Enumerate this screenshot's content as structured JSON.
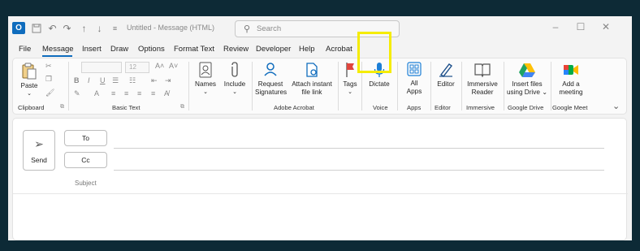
{
  "titlebar": {
    "window_title": "Untitled - Message (HTML)",
    "search_placeholder": "Search",
    "icons": [
      "outlook-logo-icon",
      "save-icon",
      "undo-icon",
      "redo-icon",
      "up-arrow-icon",
      "down-arrow-icon",
      "customize-icon",
      "minimize-icon",
      "maximize-icon",
      "close-icon"
    ]
  },
  "menu": {
    "tabs": [
      "File",
      "Message",
      "Insert",
      "Draw",
      "Options",
      "Format Text",
      "Review",
      "Developer",
      "Help",
      "Acrobat"
    ],
    "active_tab": "Message"
  },
  "ribbon": {
    "paste": "Paste",
    "font_size_value": "12",
    "names": "Names",
    "include": "Include",
    "request_signatures": [
      "Request",
      "Signatures"
    ],
    "attach_instant": [
      "Attach instant",
      "file link"
    ],
    "tags": "Tags",
    "dictate": "Dictate",
    "all_apps": [
      "All",
      "Apps"
    ],
    "editor": "Editor",
    "immersive_reader": [
      "Immersive",
      "Reader"
    ],
    "insert_files_drive": [
      "Insert files",
      "using Drive"
    ],
    "add_meeting": [
      "Add a",
      "meeting"
    ],
    "groups": {
      "clipboard": "Clipboard",
      "basic_text": "Basic Text",
      "adobe_acrobat": "Adobe Acrobat",
      "voice": "Voice",
      "apps": "Apps",
      "editor": "Editor",
      "immersive": "Immersive",
      "google_drive": "Google Drive",
      "google_meet": "Google Meet"
    }
  },
  "compose": {
    "send": "Send",
    "to": "To",
    "cc": "Cc",
    "subject": "Subject"
  },
  "colors": {
    "frame": "#0d2a36",
    "accent": "#0f6cbd",
    "highlight": "#f5ec00"
  }
}
